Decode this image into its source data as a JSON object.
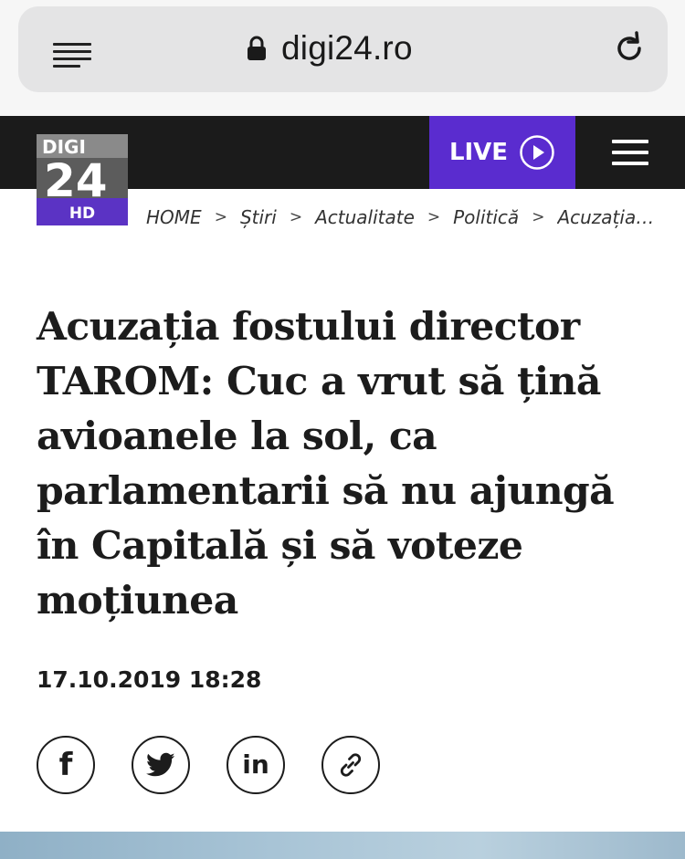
{
  "browser": {
    "url": "digi24.ro",
    "reader_icon": "reader-mode-icon",
    "lock_icon": "lock-icon",
    "reload_icon": "reload-icon"
  },
  "header": {
    "logo": {
      "top_text": "DIGI",
      "number_text": "24",
      "badge_text": "HD"
    },
    "live_label": "LIVE",
    "live_icon": "play-circle-icon",
    "menu_icon": "hamburger-menu-icon",
    "colors": {
      "bar": "#1b1b1b",
      "live": "#5a2ccf",
      "logo_badge": "#5b33c4"
    }
  },
  "breadcrumb": {
    "items": [
      "HOME",
      "Știri",
      "Actualitate",
      "Politică",
      "Acuzația…"
    ],
    "separator": ">"
  },
  "article": {
    "title": "Acuzația fostului director TAROM: Cuc a vrut să țină avioanele la sol, ca parlamentarii să nu ajungă în Capitală și să voteze moțiunea",
    "datetime": "17.10.2019 18:28"
  },
  "share": {
    "facebook_glyph": "f",
    "linkedin_glyph": "in",
    "icons": [
      "facebook-icon",
      "twitter-icon",
      "linkedin-icon",
      "link-icon"
    ]
  }
}
